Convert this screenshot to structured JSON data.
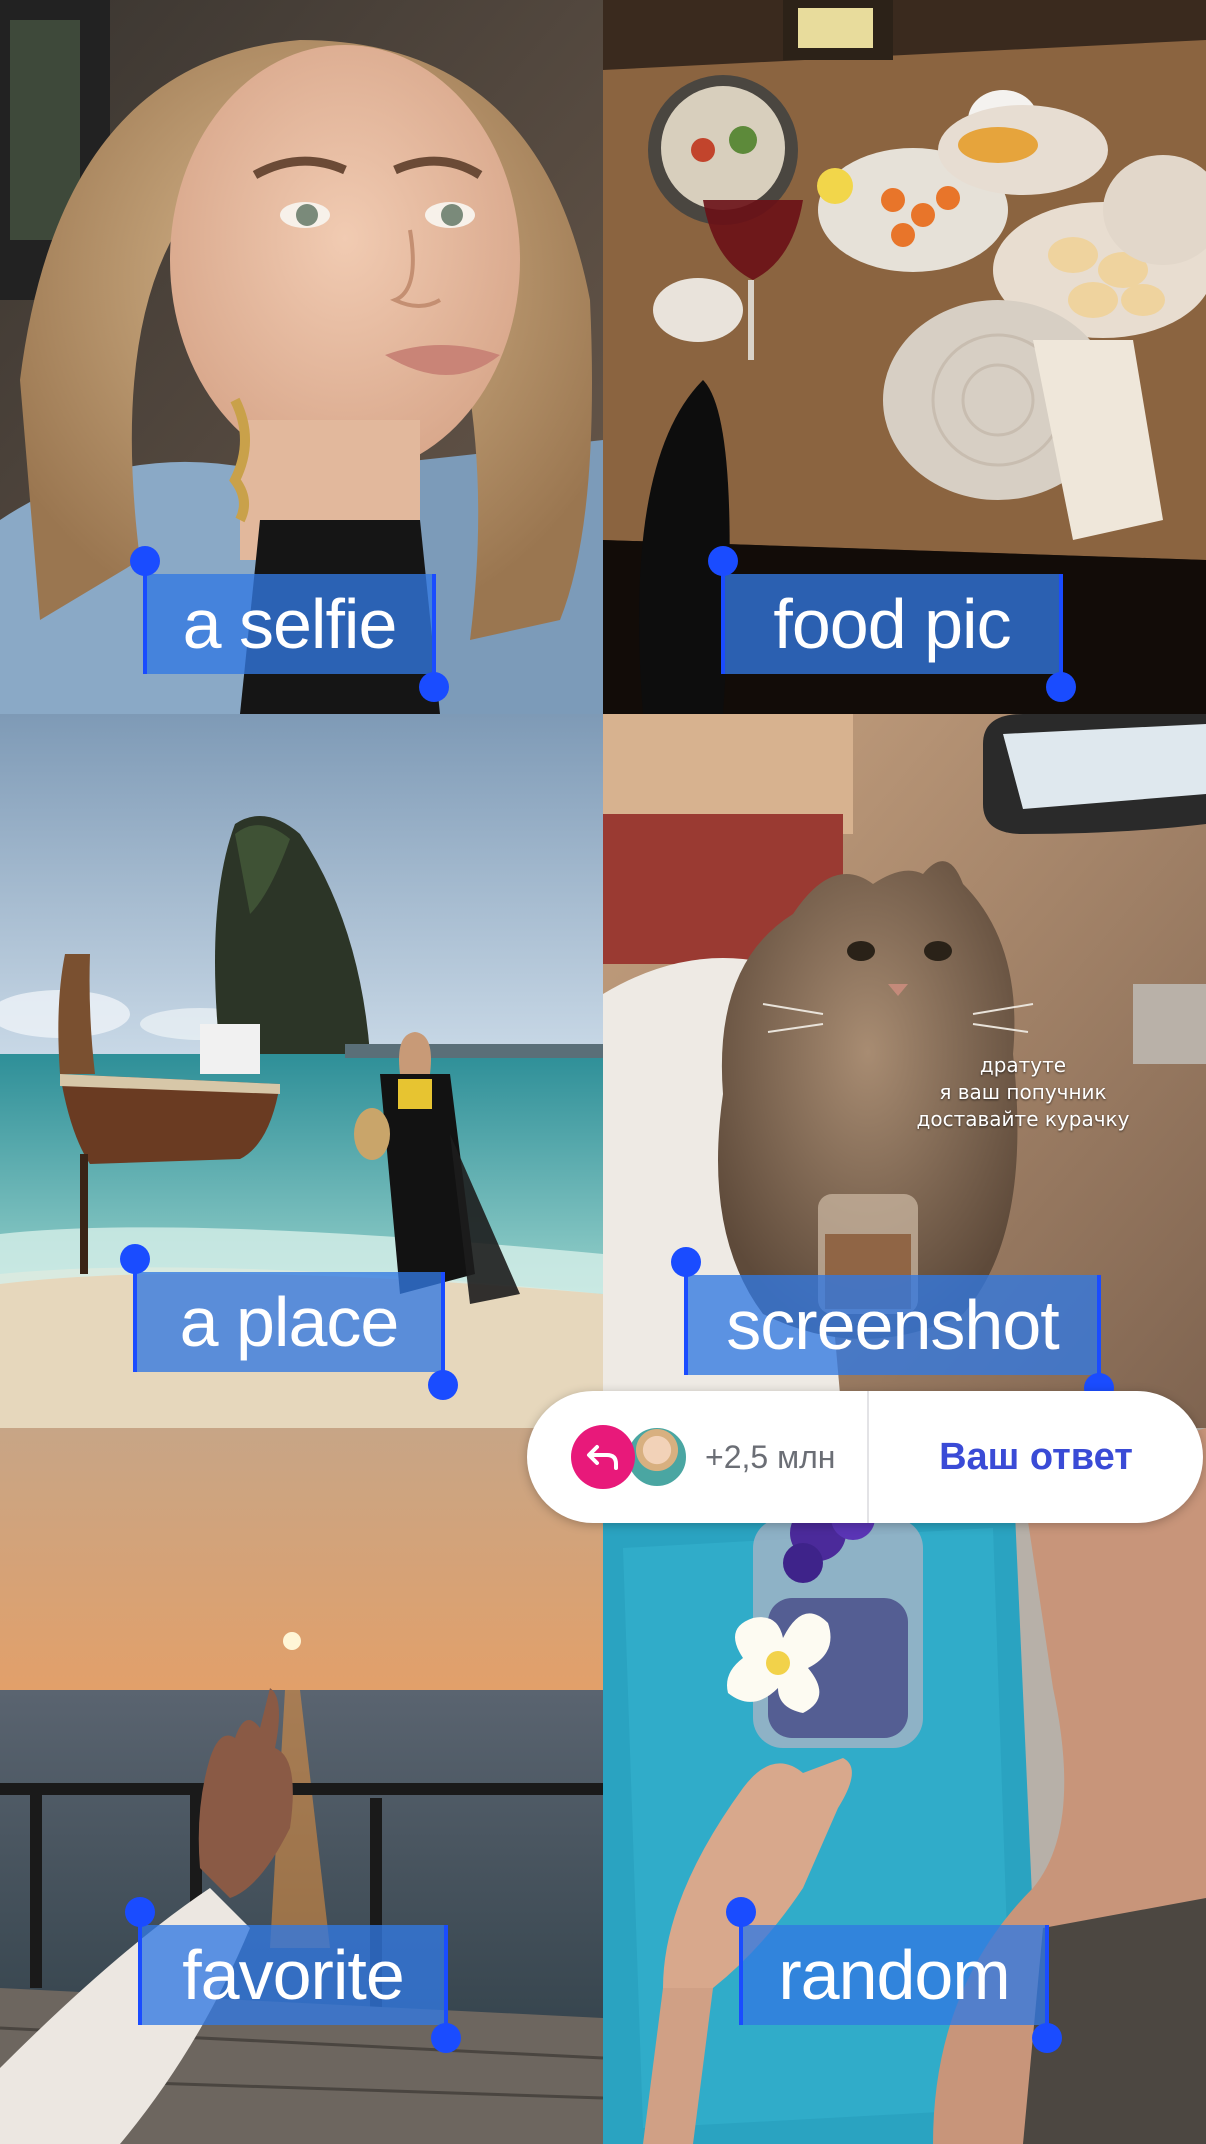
{
  "tiles": [
    {
      "label": "a selfie"
    },
    {
      "label": "food pic"
    },
    {
      "label": "a place"
    },
    {
      "label": "screenshot"
    },
    {
      "label": "favorite"
    },
    {
      "label": "random"
    }
  ],
  "cat_caption": {
    "line1": "дратуте",
    "line2": "я ваш попучник",
    "line3": "доставайте курачку"
  },
  "reply_bar": {
    "count": "+2,5 млн",
    "answer_label": "Ваш ответ"
  },
  "colors": {
    "selection_fill": "#3278e1",
    "selection_handle": "#1a4cff",
    "reply_icon": "#e8197a",
    "answer_text": "#3a4bd6"
  },
  "icons": [
    "reply-arrow-icon",
    "avatar"
  ]
}
